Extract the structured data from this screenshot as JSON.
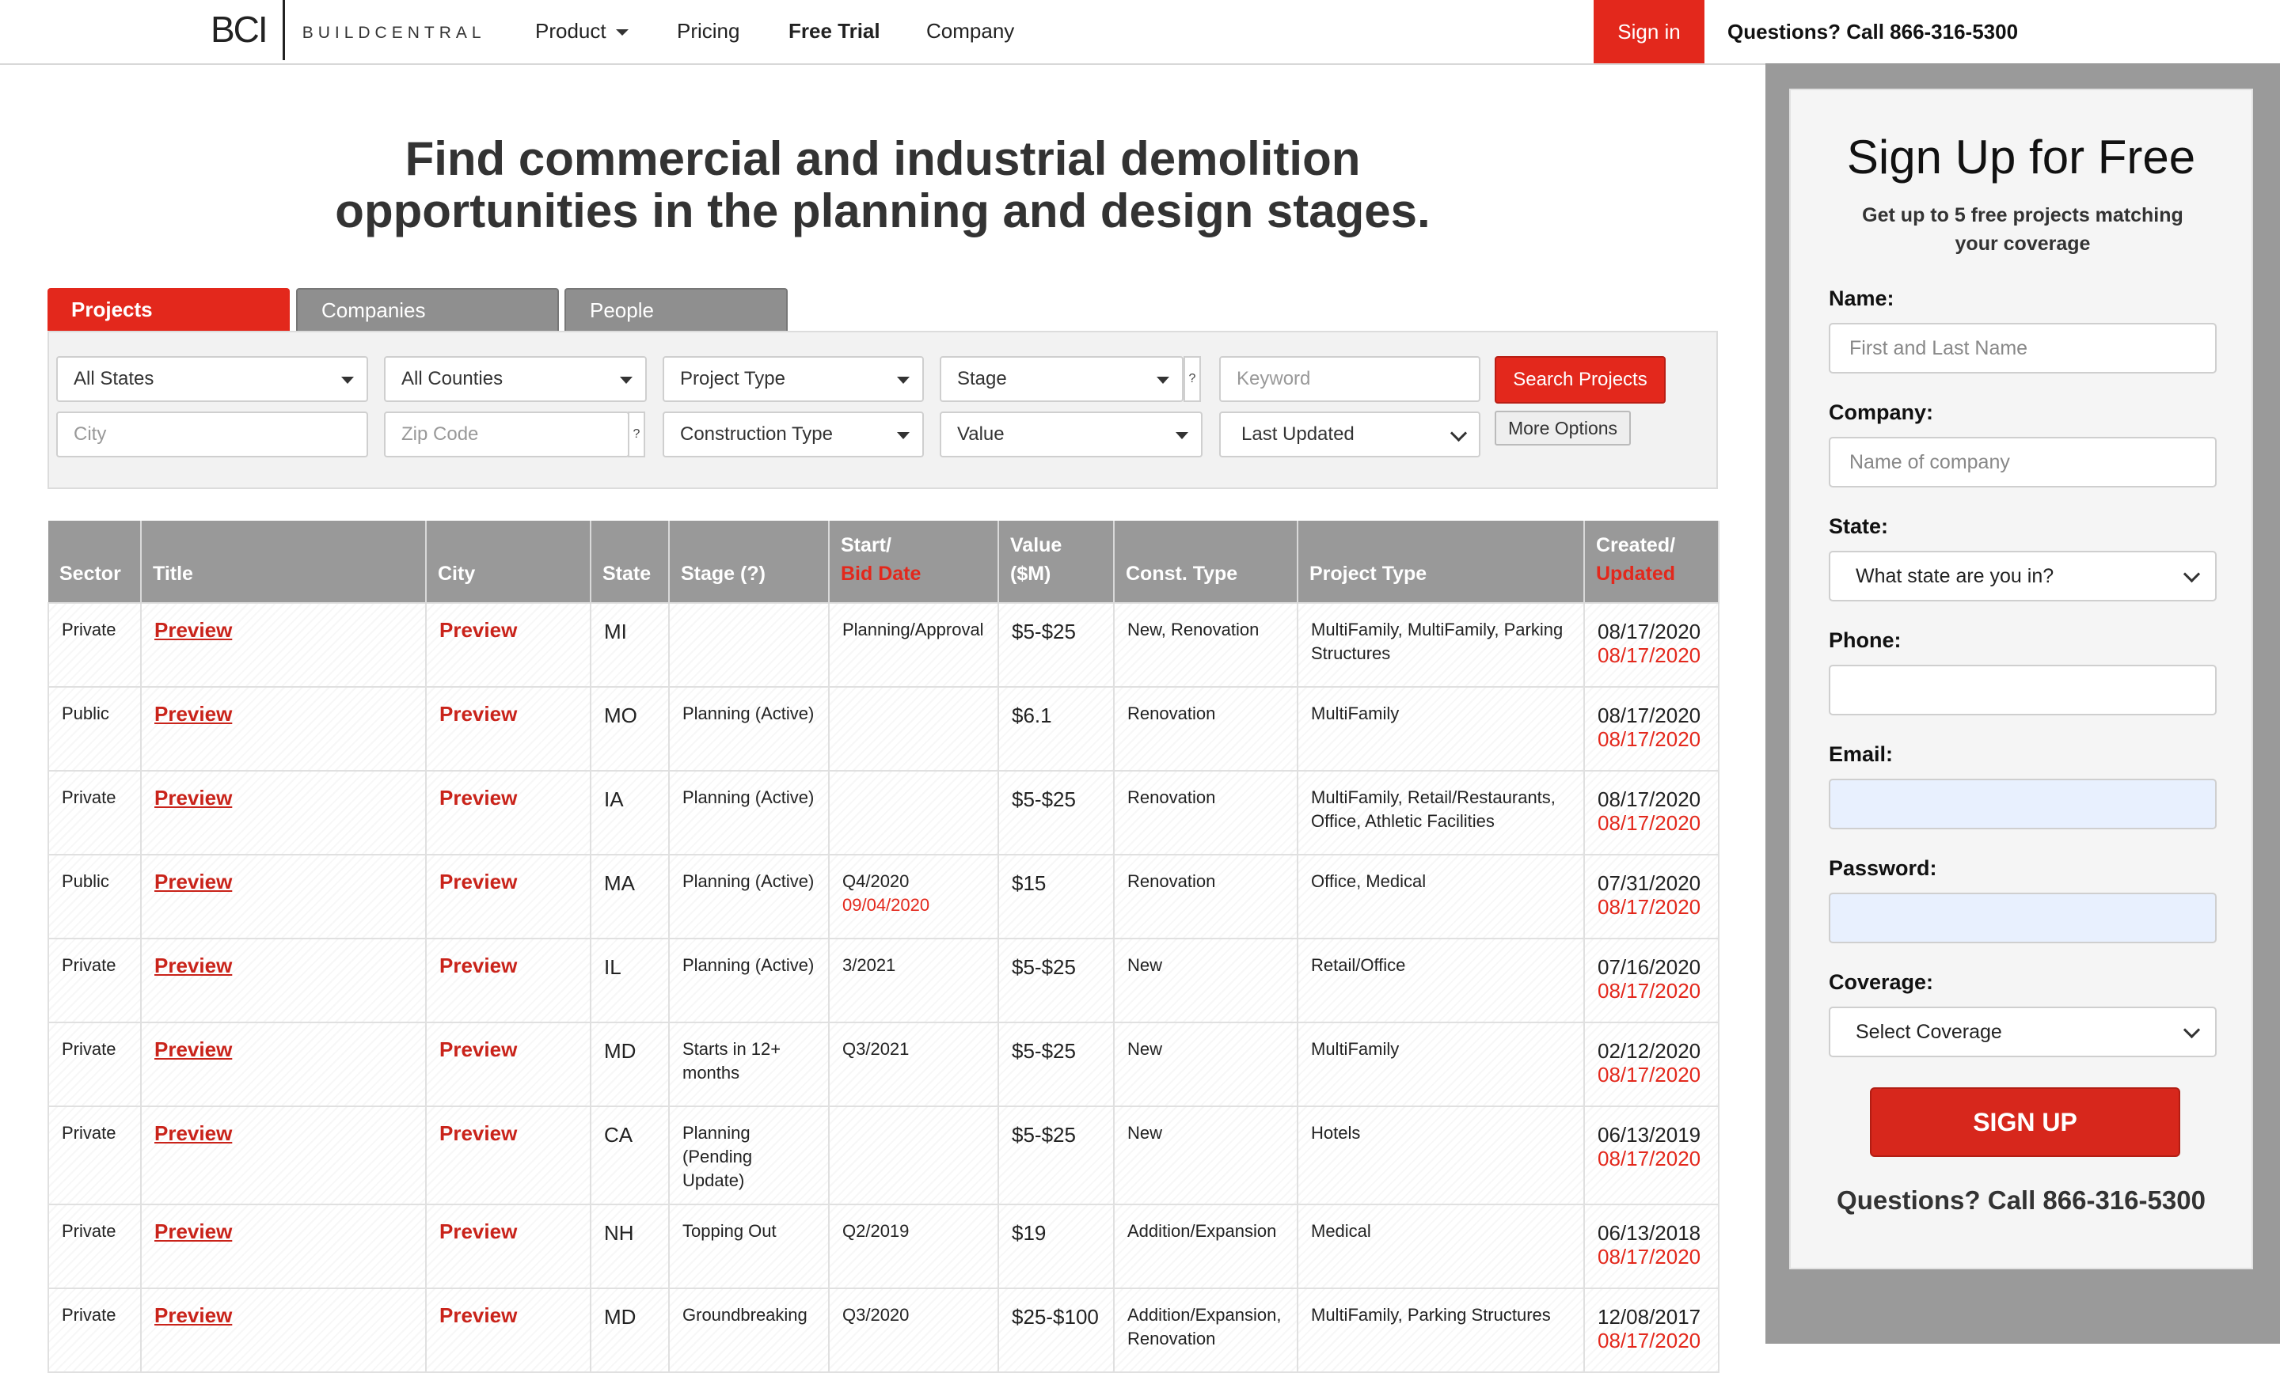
{
  "header": {
    "logo_mark": "BCI",
    "logo_word": "BUILDCENTRAL",
    "nav": {
      "product": "Product",
      "pricing": "Pricing",
      "free_trial": "Free Trial",
      "company": "Company"
    },
    "signin": "Sign in",
    "phone": "Questions? Call 866-316-5300"
  },
  "hero": {
    "line1": "Find commercial and industrial demolition",
    "line2": "opportunities in the planning and design stages."
  },
  "tabs": {
    "projects": "Projects",
    "companies": "Companies",
    "people": "People"
  },
  "filters": {
    "states": "All States",
    "counties": "All Counties",
    "project_type": "Project Type",
    "stage": "Stage",
    "keyword_placeholder": "Keyword",
    "city_placeholder": "City",
    "zip_placeholder": "Zip Code",
    "construction_type": "Construction Type",
    "value": "Value",
    "sort": "Last Updated",
    "help": "?",
    "search_button": "Search Projects",
    "more_options": "More Options"
  },
  "table": {
    "headers": {
      "sector": "Sector",
      "title": "Title",
      "city": "City",
      "state": "State",
      "stage": "Stage (?)",
      "start_line1": "Start/",
      "start_line2": "Bid Date",
      "value_line1": "Value",
      "value_line2": "($M)",
      "const_type": "Const. Type",
      "project_type": "Project Type",
      "created_line1": "Created/",
      "created_line2": "Updated"
    },
    "rows": [
      {
        "sector": "Private",
        "title": "Preview",
        "city": "Preview",
        "state": "MI",
        "stage": "",
        "start": "Planning/Approval",
        "bid": "",
        "value": "$5-$25",
        "const": "New, Renovation",
        "ptype": "MultiFamily, MultiFamily, Parking Structures",
        "created": "08/17/2020",
        "updated": "08/17/2020"
      },
      {
        "sector": "Public",
        "title": "Preview",
        "city": "Preview",
        "state": "MO",
        "stage": "Planning (Active)",
        "start": "",
        "bid": "",
        "value": "$6.1",
        "const": "Renovation",
        "ptype": "MultiFamily",
        "created": "08/17/2020",
        "updated": "08/17/2020"
      },
      {
        "sector": "Private",
        "title": "Preview",
        "city": "Preview",
        "state": "IA",
        "stage": "Planning (Active)",
        "start": "",
        "bid": "",
        "value": "$5-$25",
        "const": "Renovation",
        "ptype": "MultiFamily, Retail/Restaurants, Office, Athletic Facilities",
        "created": "08/17/2020",
        "updated": "08/17/2020"
      },
      {
        "sector": "Public",
        "title": "Preview",
        "city": "Preview",
        "state": "MA",
        "stage": "Planning (Active)",
        "start": "Q4/2020",
        "bid": "09/04/2020",
        "value": "$15",
        "const": "Renovation",
        "ptype": "Office, Medical",
        "created": "07/31/2020",
        "updated": "08/17/2020"
      },
      {
        "sector": "Private",
        "title": "Preview",
        "city": "Preview",
        "state": "IL",
        "stage": "Planning (Active)",
        "start": "3/2021",
        "bid": "",
        "value": "$5-$25",
        "const": "New",
        "ptype": "Retail/Office",
        "created": "07/16/2020",
        "updated": "08/17/2020"
      },
      {
        "sector": "Private",
        "title": "Preview",
        "city": "Preview",
        "state": "MD",
        "stage": "Starts in 12+ months",
        "start": "Q3/2021",
        "bid": "",
        "value": "$5-$25",
        "const": "New",
        "ptype": "MultiFamily",
        "created": "02/12/2020",
        "updated": "08/17/2020"
      },
      {
        "sector": "Private",
        "title": "Preview",
        "city": "Preview",
        "state": "CA",
        "stage": "Planning (Pending Update)",
        "start": "",
        "bid": "",
        "value": "$5-$25",
        "const": "New",
        "ptype": "Hotels",
        "created": "06/13/2019",
        "updated": "08/17/2020"
      },
      {
        "sector": "Private",
        "title": "Preview",
        "city": "Preview",
        "state": "NH",
        "stage": "Topping Out",
        "start": "Q2/2019",
        "bid": "",
        "value": "$19",
        "const": "Addition/Expansion",
        "ptype": "Medical",
        "created": "06/13/2018",
        "updated": "08/17/2020"
      },
      {
        "sector": "Private",
        "title": "Preview",
        "city": "Preview",
        "state": "MD",
        "stage": "Groundbreaking",
        "start": "Q3/2020",
        "bid": "",
        "value": "$25-$100",
        "const": "Addition/Expansion, Renovation",
        "ptype": "MultiFamily, Parking Structures",
        "created": "12/08/2017",
        "updated": "08/17/2020"
      }
    ]
  },
  "signup": {
    "title": "Sign Up for Free",
    "subtitle": "Get up to 5 free projects matching your coverage",
    "name_label": "Name:",
    "name_placeholder": "First and Last Name",
    "company_label": "Company:",
    "company_placeholder": "Name of company",
    "state_label": "State:",
    "state_value": "What state are you in?",
    "phone_label": "Phone:",
    "email_label": "Email:",
    "password_label": "Password:",
    "coverage_label": "Coverage:",
    "coverage_value": "Select Coverage",
    "button": "SIGN UP",
    "phone": "Questions? Call 866-316-5300"
  },
  "colors": {
    "brand_red": "#e3281c",
    "header_gray": "#999999",
    "sidebar_gray": "#9a9a9a"
  }
}
